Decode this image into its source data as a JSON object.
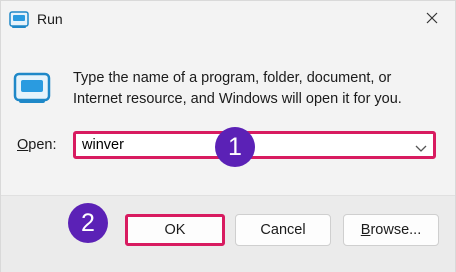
{
  "window": {
    "title": "Run",
    "close_icon": "close-icon",
    "app_icon": "run-icon"
  },
  "main": {
    "description": "Type the name of a program, folder, document, or Internet resource, and Windows will open it for you.",
    "open_label_prefix": "O",
    "open_label_rest": "pen:",
    "open_value": "winver",
    "dropdown_icon": "chevron-down-icon"
  },
  "buttons": {
    "ok": "OK",
    "cancel": "Cancel",
    "browse_prefix": "B",
    "browse_rest": "rowse..."
  },
  "annotations": {
    "step1": "1",
    "step2": "2"
  },
  "colors": {
    "highlight": "#d81b60",
    "badge": "#5b21b6",
    "icon_blue": "#1e88c8"
  }
}
